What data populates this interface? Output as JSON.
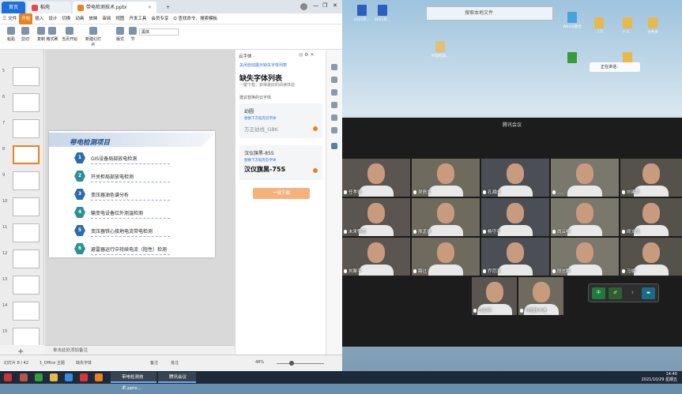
{
  "window": {
    "tab_home": "首页",
    "tab_wps": "稻壳",
    "tab_doc": "带电检测技术.pptx",
    "add_tab": "+"
  },
  "ribbon_tabs": [
    "三 文件",
    "插入",
    "设计",
    "切换",
    "动画",
    "放映",
    "审阅",
    "视图",
    "开发工具",
    "会员专享",
    "Q 查找命令、搜索模板"
  ],
  "ribbon_active": "开始",
  "toolbar": {
    "tools": [
      "粘贴",
      "剪切",
      "复制",
      "格式刷",
      "当页开始",
      "新建幻灯片",
      "版式",
      "节"
    ],
    "font_name": "黑体"
  },
  "thumbnails": [
    {
      "num": "5"
    },
    {
      "num": "6"
    },
    {
      "num": "7"
    },
    {
      "num": "8"
    },
    {
      "num": "9"
    },
    {
      "num": "10"
    },
    {
      "num": "11"
    },
    {
      "num": "12"
    },
    {
      "num": "13"
    },
    {
      "num": "14"
    },
    {
      "num": "15"
    }
  ],
  "slide": {
    "title": "带电检测项目",
    "items": [
      {
        "num": "1",
        "text": "GIS设备局部放电检测"
      },
      {
        "num": "2",
        "text": "开关柜局部放电检测"
      },
      {
        "num": "3",
        "text": "变压器油色谱分析"
      },
      {
        "num": "4",
        "text": "输变电设备红外测温检测"
      },
      {
        "num": "5",
        "text": "变压器铁心接地电流带电检测"
      },
      {
        "num": "6",
        "text": "避雷器运行中持续电流（阻性）检测"
      }
    ]
  },
  "notes_placeholder": "单击此处添加备注",
  "font_panel": {
    "header": "云字体 ·",
    "link": "关闭自动展示缺失字体列表",
    "title": "缺失字体列表",
    "subtitle": "一键下载，获得最好的阅读体验",
    "hint": "建议替换的云字体",
    "fonts": [
      {
        "name": "幼圆",
        "sub": "替换下方稻壳云字体",
        "replacement": "方正幼线_GBK"
      },
      {
        "name": "汉仪旗黑-85S",
        "sub": "替换下方稻壳云字体",
        "replacement": "汉仪旗黑-75S"
      }
    ],
    "download_button": "一键下载"
  },
  "statusbar": {
    "slide_info": "幻灯片 8 / 42",
    "theme": "1_Office 主题",
    "missing": "缺失字体",
    "notes": "备注",
    "comments": "批注",
    "zoom": "48%"
  },
  "desktop": {
    "search_placeholder": "搜索本地文件",
    "icons": [
      {
        "label": "2021年...",
        "color": "#2b5fbf"
      },
      {
        "label": "2021年...",
        "color": "#2b5fbf"
      },
      {
        "label": "带电检测...",
        "color": "#e0c07a"
      },
      {
        "label": "Win10激活",
        "color": "#4aa3d8"
      },
      {
        "label": "...(1)",
        "color": "#e7b84a"
      },
      {
        "label": "个人...",
        "color": "#e7b84a"
      },
      {
        "label": "文件夹",
        "color": "#e7b84a"
      },
      {
        "label": "...",
        "color": "#3a9b3a"
      },
      {
        "label": "...",
        "color": "#e7b84a"
      }
    ],
    "notify": "正在讲话："
  },
  "meeting": {
    "title": "腾讯会议",
    "participants": [
      {
        "name": "任孝德"
      },
      {
        "name": "吴倩文"
      },
      {
        "name": "孔湘虎"
      },
      {
        "name": "、、、"
      },
      {
        "name": "刘建华"
      },
      {
        "name": "未来等我"
      },
      {
        "name": "邢孟德"
      },
      {
        "name": "杨守平"
      },
      {
        "name": "尚云明"
      },
      {
        "name": "阎文成"
      },
      {
        "name": "刘聚平"
      },
      {
        "name": "路过"
      },
      {
        "name": "乔范滨"
      },
      {
        "name": "段志鹏"
      },
      {
        "name": "马斌"
      },
      {
        "name": "马宏明"
      },
      {
        "name": "中国联不通"
      }
    ],
    "controls": [
      "中",
      "♂",
      "☽",
      "▬"
    ]
  },
  "taskbar": {
    "tasks": [
      "带电检测技术.pptx...",
      "腾讯会议"
    ],
    "time": "14:40",
    "date": "2021/10/29 星期五"
  }
}
